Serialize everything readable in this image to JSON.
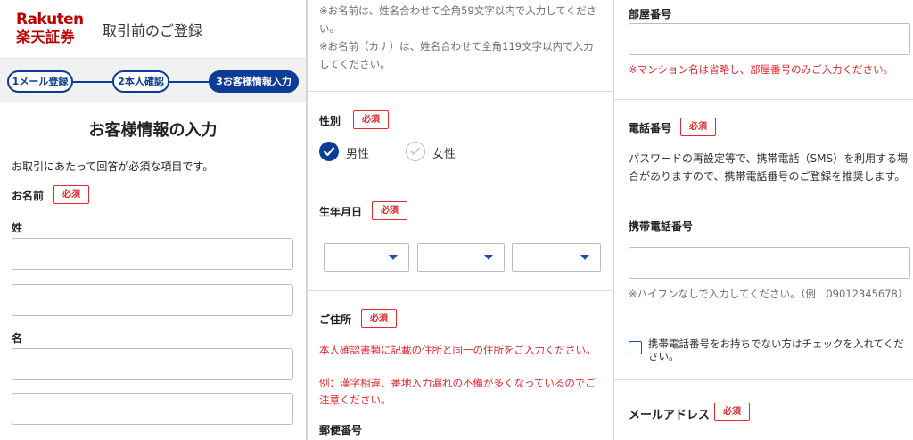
{
  "left_panel": {
    "logo_en": "Rakuten",
    "logo_ja": "楽天証券",
    "header_title": "取引前のご登録",
    "steps": [
      {
        "label": "1メール登録",
        "state": "done"
      },
      {
        "label": "2本人確認",
        "state": "done"
      },
      {
        "label": "3お客様情報入力",
        "state": "active"
      }
    ],
    "page_title": "お客様情報の入力",
    "description": "お取引にあたって回答が必須な項目です。",
    "name_label": "お名前",
    "required_badge": "必須",
    "surname_label": "姓",
    "given_name_label": "名"
  },
  "middle_panel": {
    "name_note_1": "※お名前は、姓名合わせて全角59文字以内で入力してください。",
    "name_note_2": "※お名前（カナ）は、姓名合わせて全角119文字以内で入力してください。",
    "gender_label": "性別",
    "required_badge": "必須",
    "gender_options": [
      {
        "label": "男性",
        "selected": true
      },
      {
        "label": "女性",
        "selected": false
      }
    ],
    "birthdate_label": "生年月日",
    "birthdate_selects": [
      "",
      "",
      ""
    ],
    "address_label": "ご住所",
    "address_warning": "本人確認書類に記載の住所と同一の住所をご入力ください。",
    "address_example": "例：漢字相違、番地入力漏れの不備が多くなっているのでご注意ください。",
    "postal_label": "郵便番号"
  },
  "right_panel": {
    "room_label": "部屋番号",
    "room_note": "※マンション名は省略し、部屋番号のみご入力ください。",
    "phone_label": "電話番号",
    "required_badge": "必須",
    "phone_description": "パスワードの再設定等で、携帯電話（SMS）を利用する場合がありますので、携帯電話番号のご登録を推奨します。",
    "mobile_label": "携帯電話番号",
    "mobile_note": "※ハイフンなしで入力してください。（例　09012345678）",
    "no_mobile_checkbox_label": "携帯電話番号をお持ちでない方はチェックを入れてください。",
    "no_mobile_checked": false,
    "email_label": "メールアドレス"
  },
  "colors": {
    "brand_red": "#bf0000",
    "accent_blue": "#0b3c96",
    "required_red": "#e3282e"
  }
}
